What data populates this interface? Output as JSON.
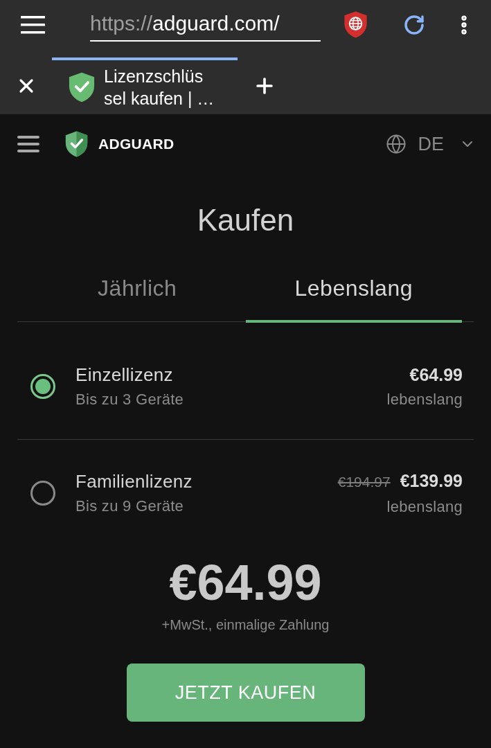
{
  "browser": {
    "address_bar": {
      "scheme": "https://",
      "host": "adguard.com/"
    },
    "tab": {
      "title_lines": [
        "Lizenzschlüs",
        "sel kaufen | …"
      ],
      "selected": true
    }
  },
  "site_header": {
    "brand": "ADGUARD",
    "language": "DE"
  },
  "page": {
    "title": "Kaufen",
    "tabs": [
      {
        "label": "Jährlich",
        "selected": false
      },
      {
        "label": "Lebenslang",
        "selected": true
      }
    ],
    "licenses": [
      {
        "name": "Einzellizenz",
        "devices": "Bis zu 3 Geräte",
        "price": "€64.99",
        "term": "lebenslang",
        "selected": true
      },
      {
        "name": "Familienlizenz",
        "devices": "Bis zu 9 Geräte",
        "old_price": "€194.97",
        "price": "€139.99",
        "term": "lebenslang",
        "selected": false
      }
    ],
    "total": "€64.99",
    "total_note": "+MwSt., einmalige Zahlung",
    "buy_button": "JETZT KAUFEN"
  }
}
